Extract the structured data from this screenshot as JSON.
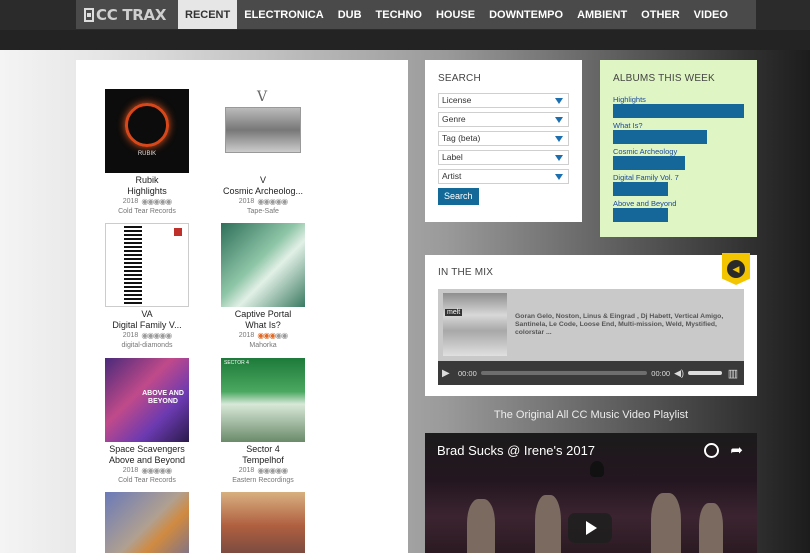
{
  "nav": {
    "logo": "CC TRAX",
    "items": [
      {
        "label": "RECENT",
        "active": true
      },
      {
        "label": "ELECTRONICA",
        "active": false
      },
      {
        "label": "DUB",
        "active": false
      },
      {
        "label": "TECHNO",
        "active": false
      },
      {
        "label": "HOUSE",
        "active": false
      },
      {
        "label": "DOWNTEMPO",
        "active": false
      },
      {
        "label": "AMBIENT",
        "active": false
      },
      {
        "label": "OTHER",
        "active": false
      },
      {
        "label": "VIDEO",
        "active": false
      }
    ]
  },
  "albums": [
    {
      "artist": "Rubik",
      "title": "Highlights",
      "year": "2018",
      "rating": 0,
      "label": "Cold Tear Records",
      "cover_text": "RUBIK"
    },
    {
      "artist": "V",
      "title": "Cosmic Archeolog...",
      "year": "2018",
      "rating": 0,
      "label": "Tape-Safe",
      "cover_text": "V"
    },
    {
      "artist": "VA",
      "title": "Digital Family V...",
      "year": "2018",
      "rating": 0,
      "label": "digital-diamonds",
      "cover_text": ""
    },
    {
      "artist": "Captive Portal",
      "title": "What Is?",
      "year": "2018",
      "rating": 3,
      "label": "Mahorka",
      "cover_text": ""
    },
    {
      "artist": "Space Scavengers",
      "title": "Above and Beyond",
      "year": "2018",
      "rating": 0,
      "label": "Cold Tear Records",
      "cover_text": "ABOVE AND BEYOND"
    },
    {
      "artist": "Sector 4",
      "title": "Tempelhof",
      "year": "2018",
      "rating": 0,
      "label": "Eastern Recordings",
      "cover_text": "SECTOR 4"
    },
    {
      "artist": "",
      "title": "",
      "year": "",
      "rating": 0,
      "label": "",
      "cover_text": ""
    },
    {
      "artist": "",
      "title": "",
      "year": "",
      "rating": 0,
      "label": "",
      "cover_text": ""
    }
  ],
  "search": {
    "title": "SEARCH",
    "fields": [
      "License",
      "Genre",
      "Tag (beta)",
      "Label",
      "Artist"
    ],
    "button": "Search"
  },
  "albums_week": {
    "title": "ALBUMS THIS WEEK",
    "items": [
      {
        "label": "Highlights",
        "value": 1.0
      },
      {
        "label": "What Is?",
        "value": 0.72
      },
      {
        "label": "Cosmic Archeology",
        "value": 0.55
      },
      {
        "label": "Digital Family Vol. 7",
        "value": 0.42
      },
      {
        "label": "Above and Beyond",
        "value": 0.42
      }
    ]
  },
  "mix": {
    "title": "IN THE MIX",
    "thumb_label": "melt",
    "artists": "Goran Gelo, Noston, Linus & Eingrad , Dj Habett, Vertical Amigo, Santinela, Le Code, Loose End, Multi-mission, Weld, Mystified, colorstar ...",
    "time_current": "00:00",
    "time_total": "00:00"
  },
  "playlist": {
    "title": "The Original All CC Music Video Playlist",
    "video_title": "Brad Sucks @ Irene's 2017"
  },
  "colors": {
    "accent": "#136a98",
    "albums_week_bg": "#dff5c3",
    "star_on": "#e06a26",
    "badge": "#f2c500"
  }
}
